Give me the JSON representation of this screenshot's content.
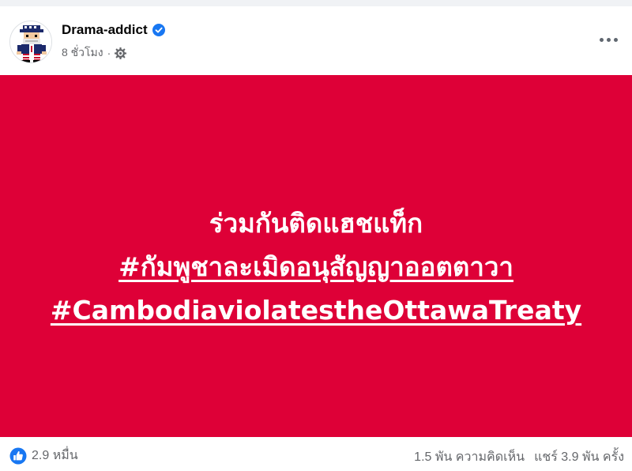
{
  "post": {
    "author": "Drama-addict",
    "time": "8 ชั่วโมง",
    "separator": "·",
    "verified": true,
    "image": {
      "background": "#de0037",
      "line1": "ร่วมกันติดแฮชแท็ก",
      "hashtag_th": "#กัมพูชาละเมิดอนุสัญญาออตตาวา",
      "hashtag_en": "#CambodiaviolatestheOttawaTreaty"
    }
  },
  "footer": {
    "reactions": "2.9 หมื่น",
    "comments": "1.5 พัน ความคิดเห็น",
    "shares": "แชร์ 3.9 พัน ครั้ง"
  },
  "icons": {
    "avatar": "pixel-character-avatar",
    "verified": "verified-badge-icon",
    "privacy": "gear-icon",
    "more": "more-options-icon",
    "like": "like-icon"
  },
  "colors": {
    "accent": "#1877f2",
    "post_background": "#de0037",
    "muted_text": "#65676b"
  }
}
